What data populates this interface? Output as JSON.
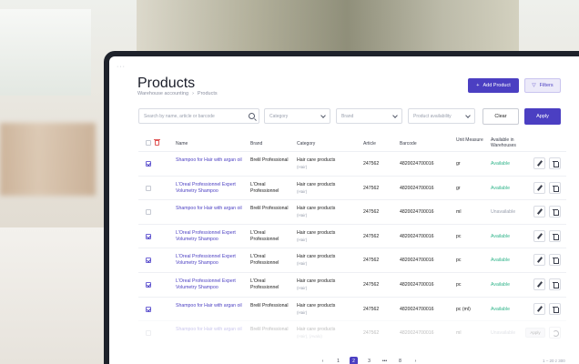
{
  "page": {
    "title": "Products",
    "breadcrumbs": [
      "Warehouse accounting",
      "Products"
    ]
  },
  "toolbar": {
    "add_label": "Add Product",
    "filters_label": "Filters",
    "search_placeholder": "Search by name, article or barcode",
    "category_placeholder": "Category",
    "brand_placeholder": "Brand",
    "availability_placeholder": "Product availability",
    "clear_label": "Clear",
    "apply_label": "Apply"
  },
  "table": {
    "headers": {
      "name": "Name",
      "brand": "Brand",
      "category": "Category",
      "article": "Article",
      "barcode": "Barcode",
      "unit": "Unit Measure",
      "available": "Available in Warehouses"
    },
    "rows": [
      {
        "checked": true,
        "name": "Shampoo for Hair with argan oil",
        "brand": "Brelil Professional",
        "category": "Hair care products",
        "sub": "(Hair)",
        "article": "247562",
        "barcode": "4820024700016",
        "unit": "gr",
        "available": "Available",
        "ok": true
      },
      {
        "checked": false,
        "name": "L'Oreal Professionnel Expert Volumetry Shampoo",
        "brand": "L'Oreal Professionnel",
        "category": "Hair care products",
        "sub": "(Hair)",
        "article": "247562",
        "barcode": "4820024700016",
        "unit": "gr",
        "available": "Available",
        "ok": true
      },
      {
        "checked": false,
        "name": "Shampoo for Hair with argan oil",
        "brand": "Brelil Professional",
        "category": "Hair care products",
        "sub": "(Hair)",
        "article": "247562",
        "barcode": "4820024700016",
        "unit": "ml",
        "available": "Unavailable",
        "ok": false
      },
      {
        "checked": true,
        "name": "L'Oreal Professionnel Expert Volumetry Shampoo",
        "brand": "L'Oreal Professionnel",
        "category": "Hair care products",
        "sub": "(Hair)",
        "article": "247562",
        "barcode": "4820024700016",
        "unit": "pc",
        "available": "Available",
        "ok": true
      },
      {
        "checked": true,
        "name": "L'Oreal Professionnel Expert Volumetry Shampoo",
        "brand": "L'Oreal Professionnel",
        "category": "Hair care products",
        "sub": "(Hair)",
        "article": "247562",
        "barcode": "4820024700016",
        "unit": "pc",
        "available": "Available",
        "ok": true
      },
      {
        "checked": true,
        "name": "L'Oreal Professionnel Expert Volumetry Shampoo",
        "brand": "L'Oreal Professionnel",
        "category": "Hair care products",
        "sub": "(Hair)",
        "article": "247562",
        "barcode": "4820024700016",
        "unit": "pc",
        "available": "Available",
        "ok": true
      },
      {
        "checked": true,
        "name": "Shampoo for Hair with argan oil",
        "brand": "Brelil Professional",
        "category": "Hair care products",
        "sub": "(Hair)",
        "article": "247562",
        "barcode": "4820024700016",
        "unit": "pc (ml)",
        "available": "Available",
        "ok": true
      },
      {
        "checked": false,
        "name": "Shampoo for Hair with argan oil",
        "brand": "Brelil Professional",
        "category": "Hair care products",
        "sub": "(Hair), (Avalo)",
        "article": "247562",
        "barcode": "4820024700016",
        "unit": "ml",
        "available": "Unavailable",
        "ok": false,
        "faded": true,
        "apply_label": "Apply"
      }
    ]
  },
  "pagination": {
    "prev": "‹",
    "pages": [
      "1",
      "2",
      "3",
      "•••",
      "8"
    ],
    "active": "2",
    "next": "›",
    "range": "1 – 20 z 300"
  }
}
